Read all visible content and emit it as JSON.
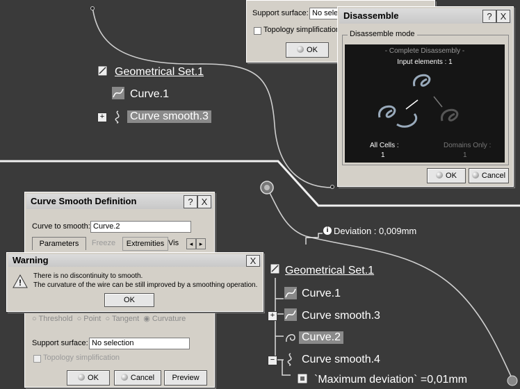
{
  "top_tree": {
    "set_label": "Geometrical Set.1",
    "curve1": "Curve.1",
    "smooth3": "Curve smooth.3"
  },
  "top_partial_dialog": {
    "support_label": "Support surface:",
    "support_value": "No selec",
    "topology_label": "Topology simplification",
    "ok_label": "OK"
  },
  "disassemble": {
    "title": "Disassemble",
    "help_btn": "?",
    "close_btn": "X",
    "mode_group": "Disassemble mode",
    "mode_caption": "- Complete Disassembly -",
    "input_elements": "Input elements : 1",
    "all_cells_label": "All Cells :",
    "all_cells_value": "1",
    "domains_only_label": "Domains Only :",
    "domains_only_value": "1",
    "ok_label": "OK",
    "cancel_label": "Cancel"
  },
  "curve_smooth_def": {
    "title": "Curve Smooth Definition",
    "help_btn": "?",
    "close_btn": "X",
    "curve_label": "Curve to smooth:",
    "curve_value": "Curve.2",
    "tabs": [
      "Parameters",
      "Freeze",
      "Extremities",
      "Vis"
    ],
    "radio_options": [
      "Threshold",
      "Point",
      "Tangent",
      "Curvature"
    ],
    "support_label": "Support surface:",
    "support_value": "No selection",
    "topology_label": "Topology simplification",
    "ok_label": "OK",
    "cancel_label": "Cancel",
    "preview_label": "Preview"
  },
  "warning": {
    "title": "Warning",
    "close_btn": "X",
    "line1": "There is no discontinuity to smooth.",
    "line2": "The curvature of the wire can be still improved by a smoothing operation.",
    "ok_label": "OK"
  },
  "bottom_tree": {
    "deviation": "Deviation : 0,009mm",
    "set_label": "Geometrical Set.1",
    "curve1": "Curve.1",
    "smooth3": "Curve smooth.3",
    "curve2": "Curve.2",
    "smooth4": "Curve smooth.4",
    "max_dev": "`Maximum deviation` =0,01mm"
  },
  "colors": {
    "background": "#3a3a3a",
    "dialog": "#d4d0c8",
    "highlight": "#8a8a8a"
  }
}
